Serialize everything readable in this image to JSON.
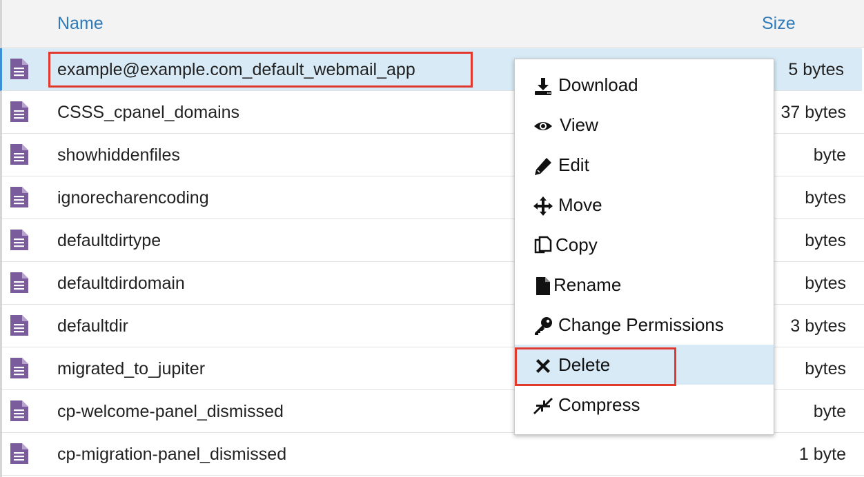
{
  "table": {
    "headers": {
      "name": "Name",
      "size": "Size"
    },
    "rows": [
      {
        "name": "example@example.com_default_webmail_app",
        "size": "5 bytes",
        "selected": true
      },
      {
        "name": "CSSS_cpanel_domains",
        "size": "37 bytes"
      },
      {
        "name": "showhiddenfiles",
        "size": "byte"
      },
      {
        "name": "ignorecharencoding",
        "size": "bytes"
      },
      {
        "name": "defaultdirtype",
        "size": "bytes"
      },
      {
        "name": "defaultdirdomain",
        "size": "bytes"
      },
      {
        "name": "defaultdir",
        "size": "3 bytes"
      },
      {
        "name": "migrated_to_jupiter",
        "size": "bytes"
      },
      {
        "name": "cp-welcome-panel_dismissed",
        "size": "byte"
      },
      {
        "name": "cp-migration-panel_dismissed",
        "size": "1 byte"
      }
    ]
  },
  "context_menu": {
    "items": [
      {
        "label": "Download",
        "icon": "download-icon"
      },
      {
        "label": "View",
        "icon": "eye-icon"
      },
      {
        "label": "Edit",
        "icon": "pencil-icon"
      },
      {
        "label": "Move",
        "icon": "move-arrows-icon"
      },
      {
        "label": "Copy",
        "icon": "copy-icon"
      },
      {
        "label": "Rename",
        "icon": "file-icon"
      },
      {
        "label": "Change Permissions",
        "icon": "key-icon"
      },
      {
        "label": "Delete",
        "icon": "x-icon",
        "active": true
      },
      {
        "label": "Compress",
        "icon": "compress-icon"
      }
    ]
  },
  "colors": {
    "header_text": "#2f7ab8",
    "file_icon": "#7a5c9c",
    "selection": "#d8eaf6",
    "highlight_box": "#e2392f"
  }
}
